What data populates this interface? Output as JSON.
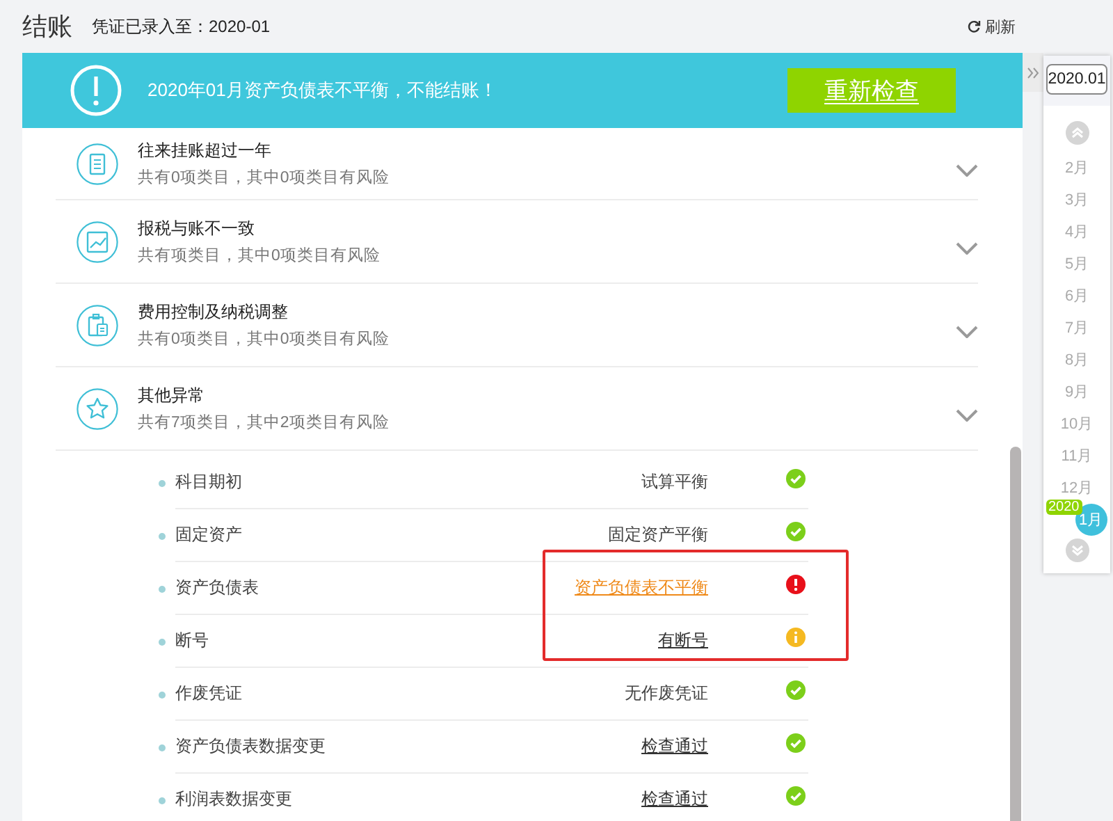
{
  "header": {
    "title": "结账",
    "subtitle": "凭证已录入至：2020-01",
    "refresh": "刷新"
  },
  "banner": {
    "message": "2020年01月资产负债表不平衡，不能结账！",
    "button": "重新检查"
  },
  "categories": [
    {
      "kind": "document",
      "title": "往来挂账超过一年",
      "summary": "共有0项类目，其中0项类目有风险"
    },
    {
      "kind": "chart",
      "title": "报税与账不一致",
      "summary": "共有项类目，其中0项类目有风险"
    },
    {
      "kind": "clipboard",
      "title": "费用控制及纳税调整",
      "summary": "共有0项类目，其中0项类目有风险"
    },
    {
      "kind": "star",
      "title": "其他异常",
      "summary": "共有7项类目，其中2项类目有风险"
    }
  ],
  "checks": [
    {
      "name": "科目期初",
      "result": "试算平衡",
      "link": false,
      "kind": "ok",
      "highlighted": false
    },
    {
      "name": "固定资产",
      "result": "固定资产平衡",
      "link": false,
      "kind": "ok",
      "highlighted": false
    },
    {
      "name": "资产负债表",
      "result": "资产负债表不平衡",
      "link": true,
      "kind": "error",
      "highlighted": true
    },
    {
      "name": "断号",
      "result": "有断号",
      "link": true,
      "kind": "warning",
      "highlighted": true
    },
    {
      "name": "作废凭证",
      "result": "无作废凭证",
      "link": false,
      "kind": "ok",
      "highlighted": false
    },
    {
      "name": "资产负债表数据变更",
      "result": "检查通过",
      "link": true,
      "kind": "ok",
      "highlighted": false
    },
    {
      "name": "利润表数据变更",
      "result": "检查通过",
      "link": true,
      "kind": "ok",
      "highlighted": false
    }
  ],
  "month_picker": {
    "value": "2020.01",
    "year_badge": "2020",
    "months": [
      {
        "label": "2月",
        "selected": false
      },
      {
        "label": "3月",
        "selected": false
      },
      {
        "label": "4月",
        "selected": false
      },
      {
        "label": "5月",
        "selected": false
      },
      {
        "label": "6月",
        "selected": false
      },
      {
        "label": "7月",
        "selected": false
      },
      {
        "label": "8月",
        "selected": false
      },
      {
        "label": "9月",
        "selected": false
      },
      {
        "label": "10月",
        "selected": false
      },
      {
        "label": "11月",
        "selected": false
      },
      {
        "label": "12月",
        "selected": false
      },
      {
        "label": "1月",
        "selected": true
      }
    ]
  }
}
